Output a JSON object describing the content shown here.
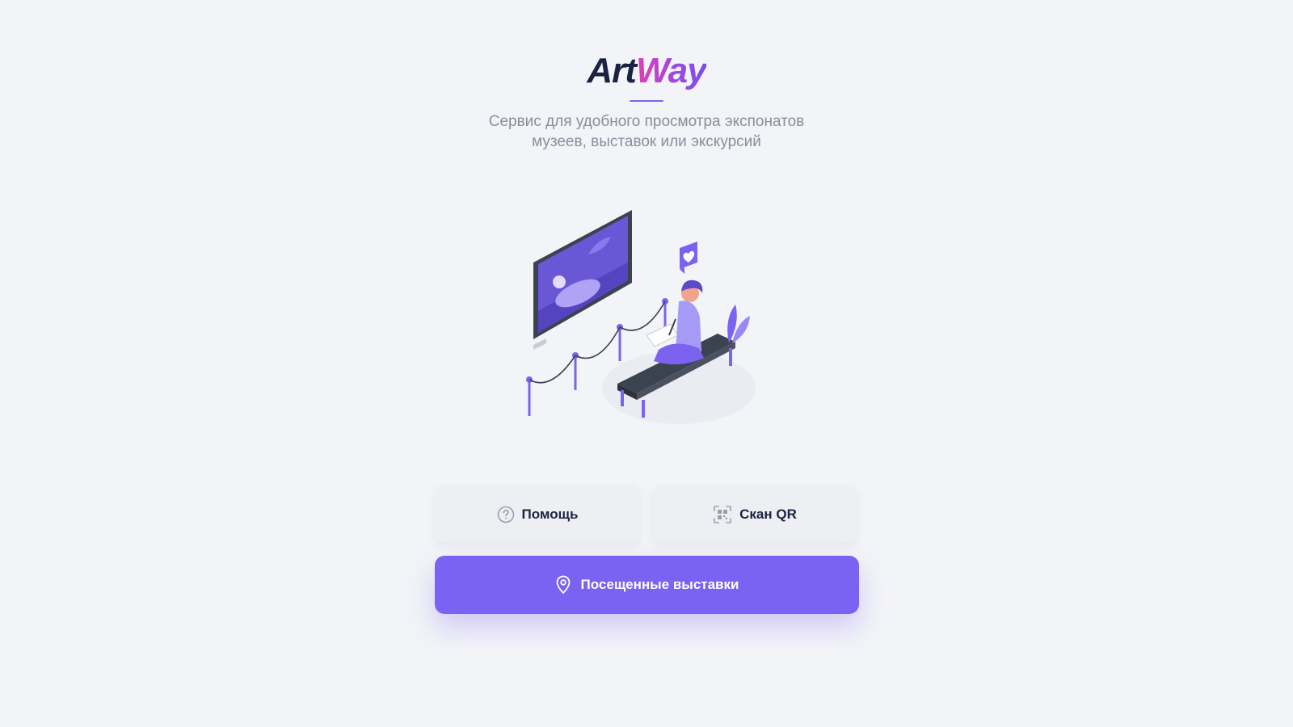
{
  "brand": {
    "logo_part1": "Art",
    "logo_part2": "Way",
    "dark_color": "#1b2342",
    "accent_gradient": [
      "#e03fb4",
      "#7a4fee"
    ]
  },
  "tagline": {
    "line1": "Сервис для удобного просмотра экспонатов",
    "line2": "музеев, выставок или экскурсий"
  },
  "illustration": {
    "description_icon": "museum-visitor-illustration"
  },
  "actions": {
    "help": {
      "label": "Помощь",
      "icon": "question-circle-icon"
    },
    "scan": {
      "label": "Скан QR",
      "icon": "qr-scan-icon"
    },
    "visited": {
      "label": "Посещенные выставки",
      "icon": "location-pin-icon"
    }
  },
  "colors": {
    "primary": "#7a63f3",
    "background": "#f3f4f8",
    "secondary_button": "#eeeff3"
  }
}
